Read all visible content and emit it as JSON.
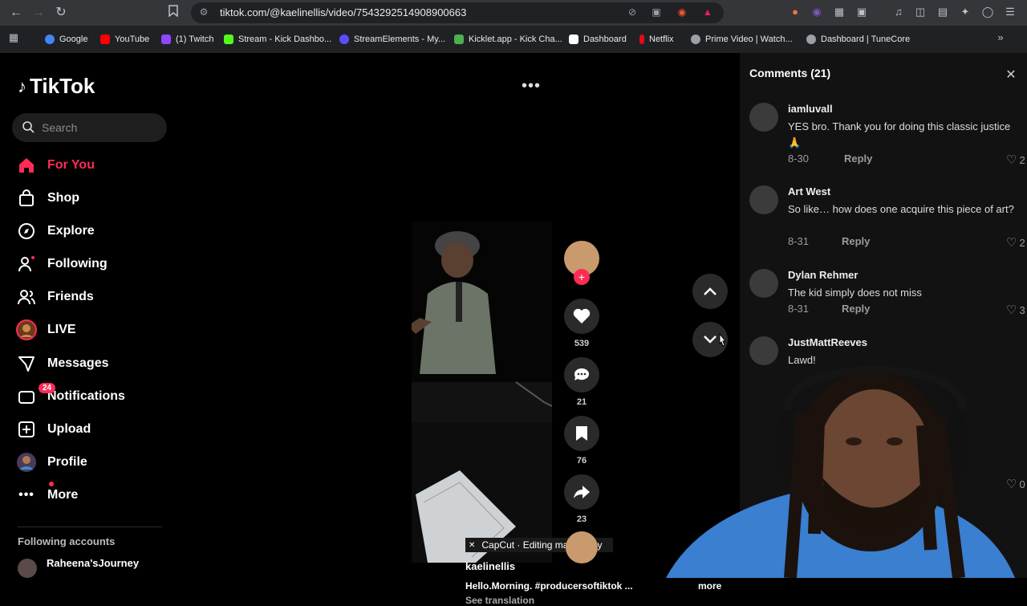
{
  "browser": {
    "url": "tiktok.com/@kaelinellis/video/7543292514908900663",
    "bookmarks": [
      {
        "label": "Google",
        "color": "#4285f4"
      },
      {
        "label": "YouTube",
        "color": "#ff0000"
      },
      {
        "label": "(1) Twitch",
        "color": "#9146ff"
      },
      {
        "label": "Stream - Kick Dashbo...",
        "color": "#53fc18"
      },
      {
        "label": "StreamElements - My...",
        "color": "#5b4eff"
      },
      {
        "label": "Kicklet.app - Kick Cha...",
        "color": "#4caf50"
      },
      {
        "label": "Dashboard",
        "color": "#ffffff"
      },
      {
        "label": "Netflix",
        "color": "#e50914"
      },
      {
        "label": "Prime Video | Watch...",
        "color": "#9aa0a6"
      },
      {
        "label": "Dashboard | TuneCore",
        "color": "#9aa0a6"
      }
    ]
  },
  "sidebar": {
    "logo": "TikTok",
    "search_placeholder": "Search",
    "nav": [
      {
        "label": "For You",
        "icon": "home-icon",
        "active": true
      },
      {
        "label": "Shop",
        "icon": "shop-icon"
      },
      {
        "label": "Explore",
        "icon": "compass-icon"
      },
      {
        "label": "Following",
        "icon": "following-icon"
      },
      {
        "label": "Friends",
        "icon": "friends-icon"
      },
      {
        "label": "LIVE",
        "icon": "live-icon"
      },
      {
        "label": "Messages",
        "icon": "messages-icon"
      },
      {
        "label": "Notifications",
        "icon": "notifications-icon",
        "badge": "24"
      },
      {
        "label": "Upload",
        "icon": "upload-icon"
      },
      {
        "label": "Profile",
        "icon": "profile-icon"
      },
      {
        "label": "More",
        "icon": "more-icon"
      }
    ],
    "following_header": "Following accounts",
    "following_first": "Raheena'sJourney"
  },
  "video": {
    "likes": "539",
    "comments": "21",
    "saves": "76",
    "shares": "23",
    "capcut": "CapCut · Editing made easy",
    "author": "kaelinellis",
    "description": "Hello.Morning. #producersoftiktok  ...",
    "more": "more",
    "translate": "See translation"
  },
  "comments": {
    "header": "Comments (21)",
    "items": [
      {
        "user": "iamluvall",
        "text": "YES bro. Thank you for doing this classic justice 🙏",
        "date": "8-30",
        "reply": "Reply",
        "likes": "2"
      },
      {
        "user": "Art West",
        "text": "So like… how does one acquire this piece of art?",
        "date": "8-31",
        "reply": "Reply",
        "likes": "2"
      },
      {
        "user": "Dylan Rehmer",
        "text": "The kid simply does not miss",
        "date": "8-31",
        "reply": "Reply",
        "likes": "3"
      },
      {
        "user": "JustMattReeves",
        "text": "Lawd!",
        "likes": "0"
      }
    ]
  },
  "colors": {
    "accent": "#fe2c55"
  }
}
